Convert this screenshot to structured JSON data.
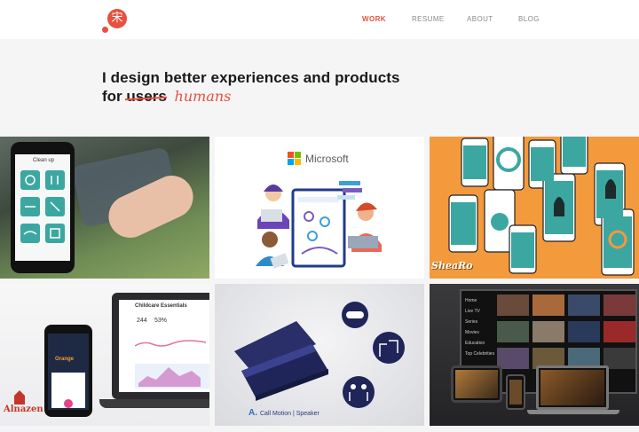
{
  "nav": {
    "logo_glyph": "宋",
    "items": [
      {
        "label": "WORK",
        "active": true
      },
      {
        "label": "RESUME",
        "active": false
      },
      {
        "label": "ABOUT",
        "active": false
      },
      {
        "label": "BLOG",
        "active": false
      }
    ]
  },
  "hero": {
    "line1": "I design better experiences and products",
    "line2_prefix": "for",
    "struck_word": "users",
    "handwritten_word": "humans"
  },
  "projects": [
    {
      "name": "Clean up app",
      "screen_title": "Clean up"
    },
    {
      "name": "Microsoft",
      "brand_label": "Microsoft"
    },
    {
      "name": "SheaRo",
      "brand_label": "SheaRo"
    },
    {
      "name": "Alnazen",
      "brand_label": "Alnazen",
      "dashboard_title": "Childcare Essentials",
      "stat_a": "244",
      "stat_b": "53%",
      "phone_title": "Orange"
    },
    {
      "name": "Call Motion Speaker",
      "brand_label": "Call Motion | Speaker",
      "brand_mark": "A."
    },
    {
      "name": "Streaming TV",
      "menu": [
        "Home",
        "Live TV",
        "Series",
        "Movies",
        "Education",
        "Top Celebrities"
      ]
    }
  ],
  "colors": {
    "accent": "#e94f3f",
    "nav_inactive": "#8a8a8a",
    "page_bg": "#f5f5f5",
    "shearo_bg": "#f39a3d",
    "callmo_navy": "#1f2558",
    "app_teal": "#3ba7a0"
  }
}
